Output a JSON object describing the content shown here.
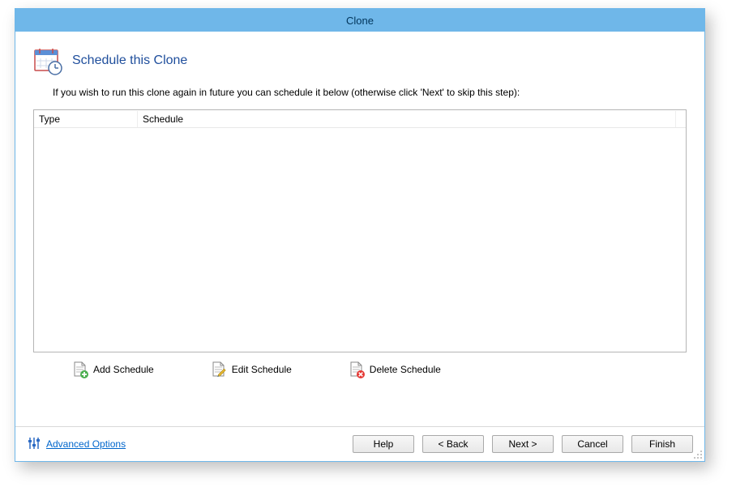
{
  "window": {
    "title": "Clone"
  },
  "header": {
    "title": "Schedule this Clone",
    "intro": "If you wish to run this clone again in future you can schedule it below (otherwise click 'Next' to skip this step):"
  },
  "table": {
    "columns": {
      "type": "Type",
      "schedule": "Schedule"
    }
  },
  "actions": {
    "add": "Add Schedule",
    "edit": "Edit Schedule",
    "delete": "Delete Schedule"
  },
  "footer": {
    "advanced": "Advanced Options",
    "help": "Help",
    "back": "< Back",
    "next": "Next >",
    "cancel": "Cancel",
    "finish": "Finish"
  }
}
